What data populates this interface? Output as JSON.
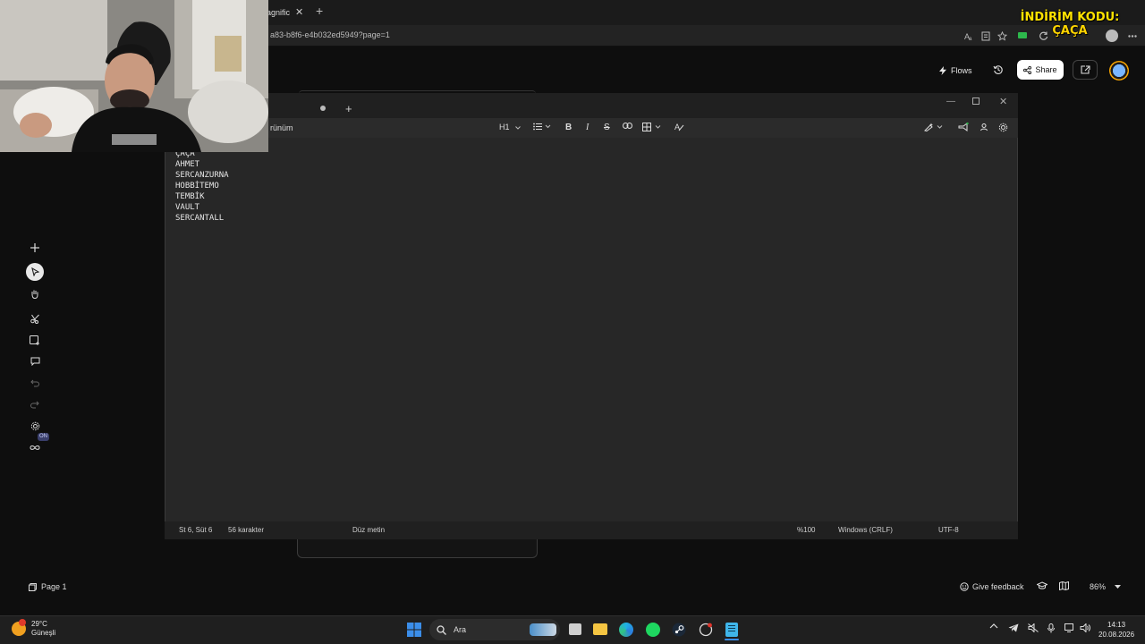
{
  "browser": {
    "tab_title": "lagnific",
    "address": "a83-b8f6-e4b032ed5949?page=1",
    "new_tab_symbol": "+",
    "close_symbol": "✕"
  },
  "promo": {
    "line1": "İNDİRİM KODU:",
    "line2": "ÇAÇA"
  },
  "header": {
    "flows_label": "Flows",
    "share_label": "Share"
  },
  "notepad": {
    "menu_partial": "rünüm",
    "heading_label": "H1",
    "lines": [
      "ÇAÇA",
      "AHMET",
      "SERCANZURNA",
      "HOBBİTEMO",
      "TEMBİK",
      "VAULT",
      "SERCANTALL"
    ],
    "status": {
      "position": "St 6, Süt 6",
      "chars": "56 karakter",
      "format": "Düz metin",
      "zoom": "%100",
      "line_ending": "Windows (CRLF)",
      "encoding": "UTF-8"
    }
  },
  "toolbar": {
    "infinite_badge": "ON"
  },
  "bottom_bar": {
    "page_label": "Page 1",
    "feedback_label": "Give feedback",
    "zoom_label": "86%"
  },
  "taskbar": {
    "temperature": "29°C",
    "weather": "Güneşli",
    "search_placeholder": "Ara",
    "time": "14:13",
    "date": "20.08.2026"
  },
  "colors": {
    "background": "#0e0e0e",
    "notepad_bg": "#272727",
    "promo_yellow": "#ffe200",
    "accent_blue": "#3b8eea"
  }
}
